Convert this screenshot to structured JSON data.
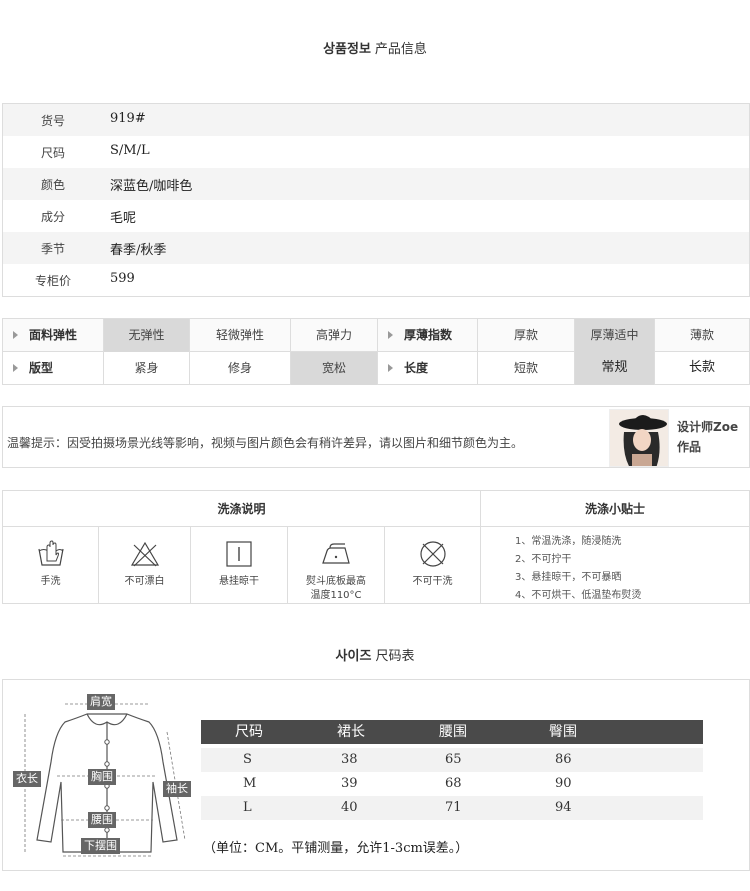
{
  "product_info": {
    "title_kr": "상품정보",
    "title_cn": "产品信息",
    "rows": [
      {
        "label": "货号",
        "value": "919#"
      },
      {
        "label": "尺码",
        "value": "S/M/L"
      },
      {
        "label": "颜色",
        "value": "深蓝色/咖啡色"
      },
      {
        "label": "成分",
        "value": "毛呢"
      },
      {
        "label": "季节",
        "value": "春季/秋季"
      },
      {
        "label": "专柜价",
        "value": "599"
      }
    ]
  },
  "attributes": {
    "row1_left": {
      "label": "面料弹性",
      "options": [
        "无弹性",
        "轻微弹性",
        "高弹力"
      ],
      "selected": "无弹性"
    },
    "row1_right": {
      "label": "厚薄指数",
      "options": [
        "厚款",
        "厚薄适中",
        "薄款"
      ],
      "selected": "厚薄适中"
    },
    "row2_left": {
      "label": "版型",
      "options": [
        "紧身",
        "修身",
        "宽松"
      ],
      "selected": "宽松"
    },
    "row2_right": {
      "label": "长度",
      "options": [
        "短款",
        "常规",
        "长款"
      ],
      "selected": "常规"
    }
  },
  "notice": {
    "text_a": "温馨提示：因受拍摄场景光线等影响，视频与图片",
    "text_b": "颜色会有稍许差异，请以图片和细节颜色为主。",
    "designer_line1": "设计师Zoe",
    "designer_line2": "作品"
  },
  "wash": {
    "heading": "洗涤说明",
    "tips_heading": "洗涤小贴士",
    "items": [
      {
        "icon": "hand-wash-icon",
        "label": "手洗"
      },
      {
        "icon": "no-bleach-icon",
        "label": "不可漂白"
      },
      {
        "icon": "hang-dry-icon",
        "label": "悬挂晾干"
      },
      {
        "icon": "iron-icon",
        "label_1": "熨斗底板最高",
        "label_2": "温度110°C"
      },
      {
        "icon": "no-dry-clean-icon",
        "label": "不可干洗"
      }
    ],
    "tips": [
      "1、常温洗涤，随浸随洗",
      "2、不可拧干",
      "3、悬挂晾干，不可暴晒",
      "4、不可烘干、低温垫布熨烫"
    ]
  },
  "size_chart": {
    "title_kr": "사이즈",
    "title_cn": "尺码表",
    "figure_labels": {
      "shoulder": "肩宽",
      "length": "衣长",
      "chest": "胸围",
      "sleeve": "袖长",
      "waist": "腰围",
      "hem": "下摆围"
    },
    "headers": [
      "尺码",
      "裙长",
      "腰围",
      "臀围"
    ],
    "rows": [
      [
        "S",
        "38",
        "65",
        "86"
      ],
      [
        "M",
        "39",
        "68",
        "90"
      ],
      [
        "L",
        "40",
        "71",
        "94"
      ]
    ],
    "note": "（单位：CM。平铺测量，允许1-3cm误差。）"
  }
}
